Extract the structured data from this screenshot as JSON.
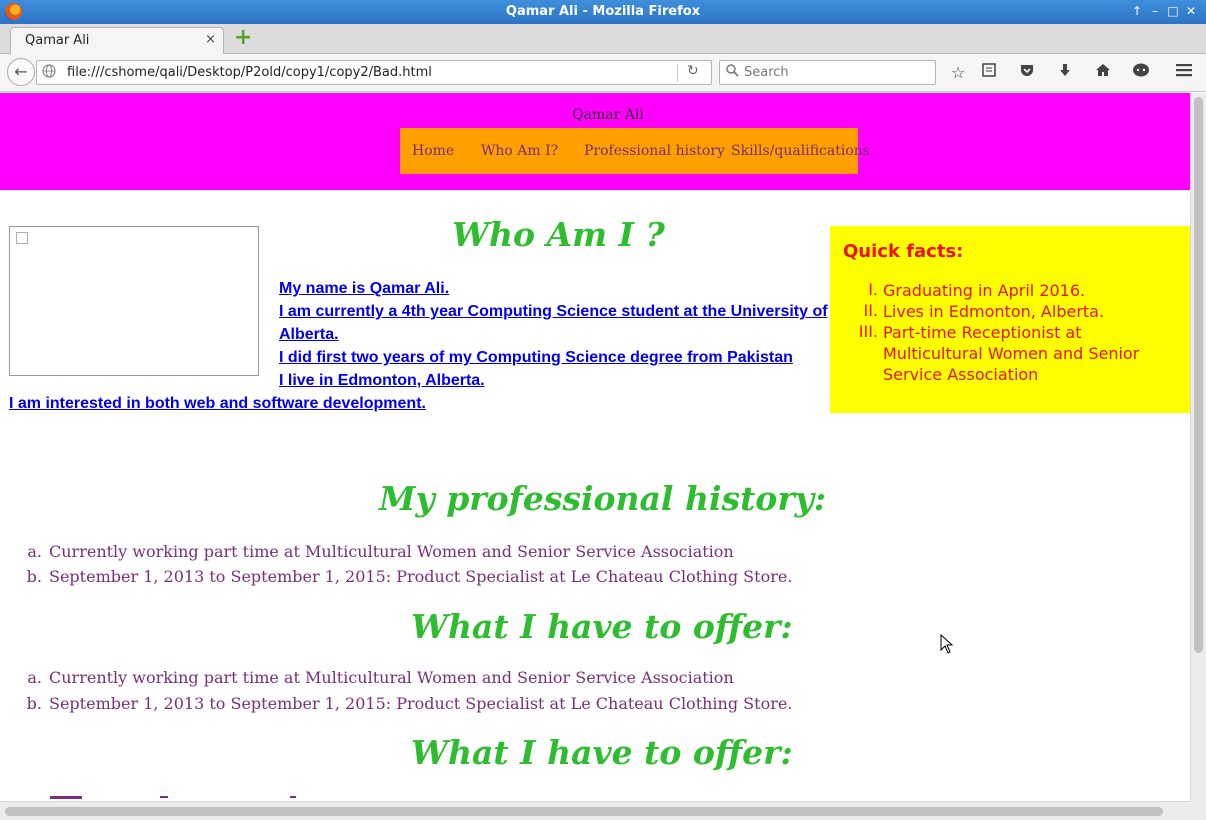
{
  "window": {
    "title": "Qamar Ali - Mozilla Firefox",
    "controls": [
      "↑",
      "–",
      "□",
      "✕"
    ]
  },
  "tabs": [
    {
      "label": "Qamar Ali",
      "close": "×"
    }
  ],
  "new_tab": "+",
  "navbar": {
    "back": "←",
    "url": "file:///cshome/qali/Desktop/P2old/copy1/copy2/Bad.html",
    "reload": "↻",
    "search_placeholder": "Search",
    "toolbar_icons": [
      "star-icon",
      "reading-list-icon",
      "pocket-icon",
      "download-icon",
      "home-icon",
      "chat-icon",
      "menu-icon"
    ]
  },
  "page": {
    "site_name": "Qamar Ali",
    "nav": [
      "Home",
      "Who Am I?",
      "Professional history",
      "Skills/qualifications"
    ],
    "who_heading": "Who Am I ?",
    "intro_lines": [
      "My name is Qamar Ali.",
      "I am currently a 4th year Computing Science student at the University of",
      "Alberta.",
      "I did first two years of my Computing Science degree from Pakistan",
      "I live in Edmonton, Alberta.",
      "I am interested in both web and software development."
    ],
    "quick_facts": {
      "title": "Quick facts:",
      "numbers": [
        "I.",
        "II.",
        "III."
      ],
      "items": [
        "Graduating in April 2016.",
        "Lives in Edmonton, Alberta.",
        "Part-time Receptionist at",
        "Multicultural Women and Senior",
        "Service Association"
      ]
    },
    "professional_heading": "My professional history:",
    "history_markers": [
      "a.",
      "b."
    ],
    "history": [
      "Currently working part time at Multicultural Women and Senior Service Association",
      "September 1, 2013 to September 1, 2015: Product Specialist at Le Chateau Clothing Store."
    ],
    "offer_heading": "What I have to offer:",
    "offer": [
      "Currently working part time at Multicultural Women and Senior Service Association",
      "September 1, 2013 to September 1, 2015: Product Specialist at Le Chateau Clothing Store."
    ],
    "offer_heading_2": "What I have to offer:"
  },
  "colors": {
    "header_bg": "#ff00ff",
    "nav_bg": "#ff9f00",
    "heading": "#2ebd2e",
    "facts_bg": "#ffff00",
    "facts_text": "#ee1111",
    "list_text": "#7a2d7a",
    "link": "#0000ee"
  }
}
